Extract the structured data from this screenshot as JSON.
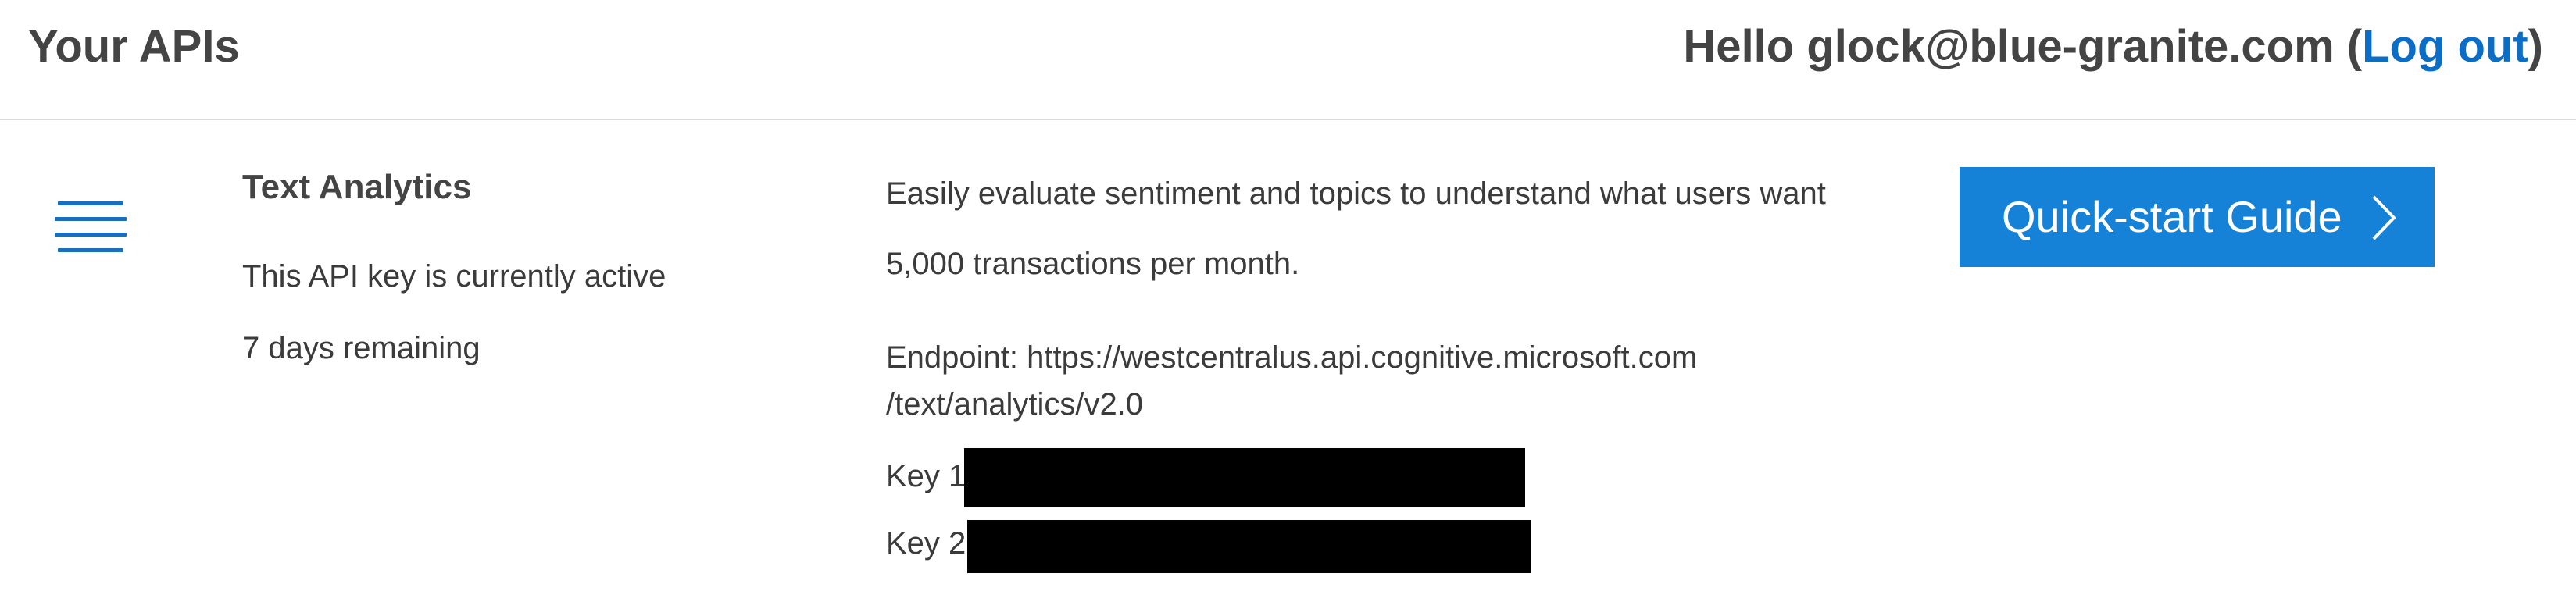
{
  "header": {
    "title": "Your APIs",
    "greeting_prefix": "Hello glock@blue-granite.com (",
    "logout_label": "Log out",
    "greeting_suffix": ")"
  },
  "api": {
    "name": "Text Analytics",
    "status": "This API key is currently active",
    "remaining": "7 days remaining",
    "description": "Easily evaluate sentiment and topics to understand what users want",
    "quota": "5,000 transactions per month.",
    "endpoint_line1": "Endpoint: https://westcentralus.api.cognitive.microsoft.com",
    "endpoint_line2": "/text/analytics/v2.0",
    "key1_label": "Key 1:",
    "key2_label": "Key 2:",
    "quickstart_label": "Quick-start Guide"
  },
  "icons": {
    "menu": "hamburger-menu-icon",
    "chevron": "chevron-right-icon"
  },
  "colors": {
    "accent": "#1582d8",
    "link": "#0b6dc6",
    "menu_icon": "#1a6fbd"
  }
}
